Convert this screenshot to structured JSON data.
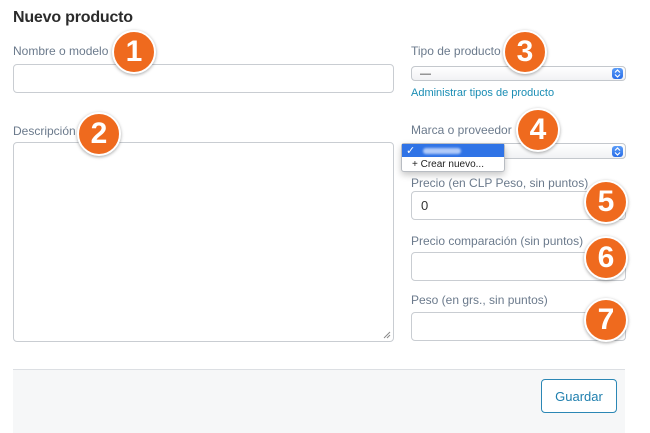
{
  "title": "Nuevo producto",
  "fields": {
    "nombre": {
      "label": "Nombre o modelo",
      "value": ""
    },
    "descripcion": {
      "label": "Descripción",
      "value": ""
    },
    "tipo": {
      "label": "Tipo de producto",
      "selected": "—",
      "link": "Administrar tipos de producto"
    },
    "marca": {
      "label": "Marca o proveedor",
      "checkmark": "✓",
      "create_option": "+ Crear nuevo..."
    },
    "precio": {
      "label": "Precio (en CLP Peso, sin puntos)",
      "value": "0"
    },
    "precio_comparacion": {
      "label": "Precio comparación (sin puntos)",
      "value": ""
    },
    "peso": {
      "label": "Peso (en grs., sin puntos)",
      "value": ""
    }
  },
  "badges": [
    "1",
    "2",
    "3",
    "4",
    "5",
    "6",
    "7"
  ],
  "footer": {
    "save_label": "Guardar"
  },
  "colors": {
    "badge": "#ef6a1e",
    "link": "#1a8db4",
    "select_highlight": "#2f73e6"
  }
}
